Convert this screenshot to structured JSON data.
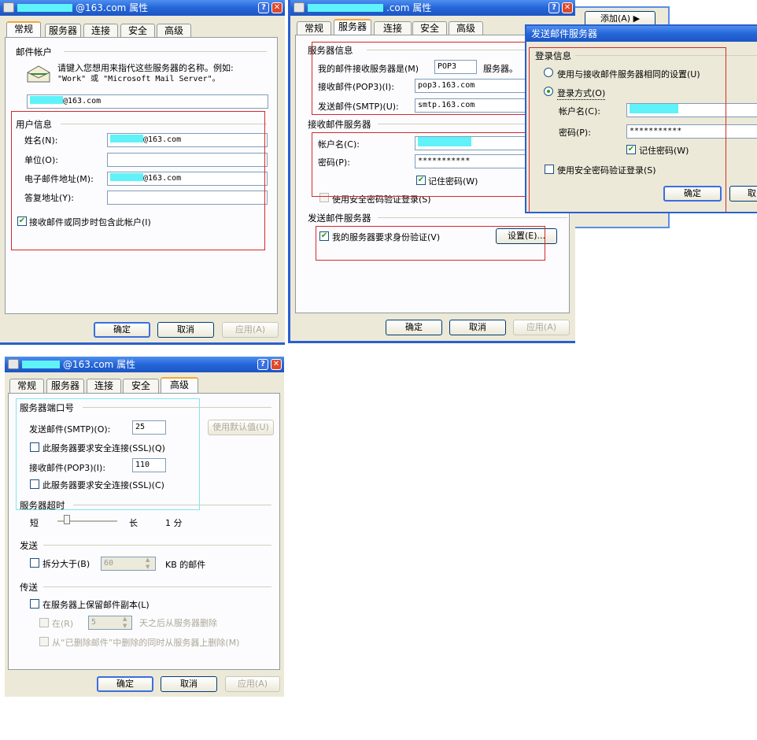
{
  "dialog1": {
    "title_suffix": "@163.com 属性",
    "tabs": [
      "常规",
      "服务器",
      "连接",
      "安全",
      "高级"
    ],
    "mail_account_heading": "邮件帐户",
    "mail_account_desc_line1": "请键入您想用来指代这些服务器的名称。例如:",
    "mail_account_desc_line2": "\"Work\" 或 \"Microsoft Mail Server\"。",
    "account_name_suffix": "@163.com",
    "user_info_heading": "用户信息",
    "name_label": "姓名(N):",
    "name_value_suffix": "@163.com",
    "org_label": "单位(O):",
    "email_label": "电子邮件地址(M):",
    "email_value_suffix": "@163.com",
    "reply_label": "答复地址(Y):",
    "include_label": "接收邮件或同步时包含此帐户(I)",
    "ok": "确定",
    "cancel": "取消",
    "apply": "应用(A)"
  },
  "dialog2": {
    "title_suffix": ".com 属性",
    "tabs": [
      "常规",
      "服务器",
      "连接",
      "安全",
      "高级"
    ],
    "server_info_heading": "服务器信息",
    "incoming_type_label": "我的邮件接收服务器是(M)",
    "incoming_type_value": "POP3",
    "incoming_type_suffix": "服务器。",
    "pop3_label": "接收邮件(POP3)(I):",
    "pop3_value": "pop3.163.com",
    "smtp_label": "发送邮件(SMTP)(U):",
    "smtp_value": "smtp.163.com",
    "incoming_heading": "接收邮件服务器",
    "account_label": "帐户名(C):",
    "password_label": "密码(P):",
    "password_value": "***********",
    "remember_label": "记住密码(W)",
    "spa_label": "使用安全密码验证登录(S)",
    "outgoing_heading": "发送邮件服务器",
    "auth_label": "我的服务器要求身份验证(V)",
    "settings_button": "设置(E)...",
    "ok": "确定",
    "cancel": "取消",
    "apply": "应用(A)"
  },
  "context_menu": {
    "add": "添加(A)"
  },
  "dialog3": {
    "title": "发送邮件服务器",
    "login_heading": "登录信息",
    "same_settings_label": "使用与接收邮件服务器相同的设置(U)",
    "login_with_label": "登录方式(O)",
    "account_label": "帐户名(C):",
    "password_label": "密码(P):",
    "password_value": "***********",
    "remember_label": "记住密码(W)",
    "spa_label": "使用安全密码验证登录(S)",
    "ok": "确定",
    "cancel_partial": "取"
  },
  "dialog4": {
    "title_suffix": "@163.com 属性",
    "tabs": [
      "常规",
      "服务器",
      "连接",
      "安全",
      "高级"
    ],
    "ports_heading": "服务器端口号",
    "smtp_port_label": "发送邮件(SMTP)(O):",
    "smtp_port_value": "25",
    "use_default_button": "使用默认值(U)",
    "smtp_ssl_label": "此服务器要求安全连接(SSL)(Q)",
    "pop3_port_label": "接收邮件(POP3)(I):",
    "pop3_port_value": "110",
    "pop3_ssl_label": "此服务器要求安全连接(SSL)(C)",
    "timeout_heading": "服务器超时",
    "timeout_short": "短",
    "timeout_long": "长",
    "timeout_value": "1 分",
    "send_heading": "发送",
    "split_label": "拆分大于(B)",
    "split_value": "60",
    "split_unit": "KB 的邮件",
    "delivery_heading": "传送",
    "leave_copy_label": "在服务器上保留邮件副本(L)",
    "remove_after_label": "在(R)",
    "remove_after_value": "5",
    "remove_after_suffix": "天之后从服务器删除",
    "remove_deleted_label": "从“已删除邮件”中删除的同时从服务器上删除(M)",
    "ok": "确定",
    "cancel": "取消",
    "apply": "应用(A)"
  }
}
